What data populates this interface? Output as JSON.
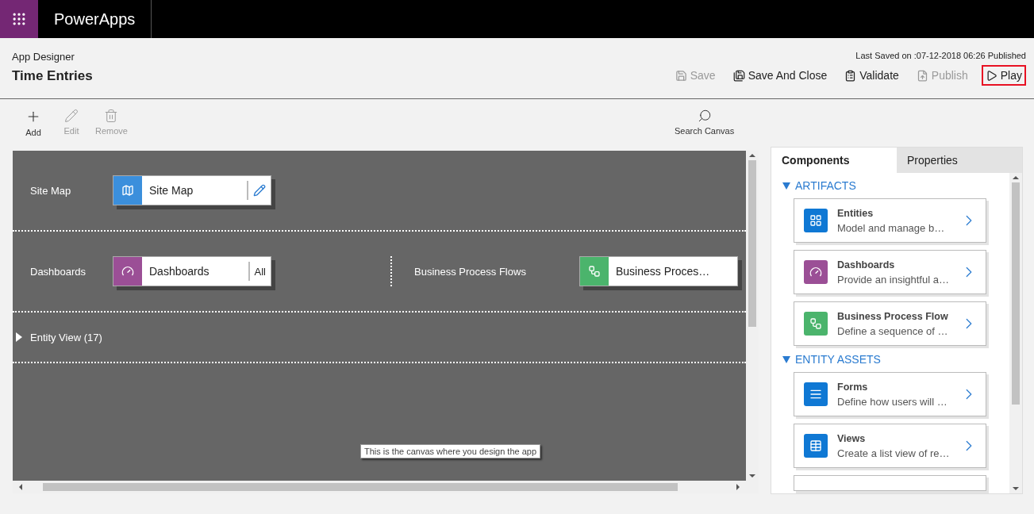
{
  "app_bar": {
    "title": "PowerApps"
  },
  "header": {
    "subtitle": "App Designer",
    "title": "Time Entries",
    "status": "Last Saved on :07-12-2018 06:26 Published",
    "actions": [
      {
        "kind": "save",
        "label": "Save",
        "disabled": true,
        "highlighted": false
      },
      {
        "kind": "save-close",
        "label": "Save And Close",
        "disabled": false,
        "highlighted": false
      },
      {
        "kind": "validate",
        "label": "Validate",
        "disabled": false,
        "highlighted": false
      },
      {
        "kind": "publish",
        "label": "Publish",
        "disabled": true,
        "highlighted": false
      },
      {
        "kind": "play",
        "label": "Play",
        "disabled": false,
        "highlighted": true
      }
    ]
  },
  "toolbar": {
    "tools": [
      {
        "kind": "add",
        "label": "Add",
        "disabled": false
      },
      {
        "kind": "edit",
        "label": "Edit",
        "disabled": true
      },
      {
        "kind": "remove",
        "label": "Remove",
        "disabled": true
      }
    ],
    "search": {
      "label": "Search Canvas"
    }
  },
  "canvas": {
    "rows": [
      {
        "groups": [
          {
            "label": "Site Map",
            "tile": {
              "kind": "map",
              "name": "Site Map",
              "color": "#3b8fdc",
              "action": {
                "kind": "edit"
              }
            }
          }
        ]
      },
      {
        "groups": [
          {
            "label": "Dashboards",
            "tile": {
              "kind": "dashboard",
              "name": "Dashboards",
              "color": "#9b4f96",
              "action": {
                "kind": "text",
                "label": "All"
              }
            }
          },
          {
            "label": "Business Process Flows",
            "tile": {
              "kind": "flow",
              "name": "Business Proces…",
              "color": "#4bb46c"
            }
          }
        ]
      }
    ],
    "entity_view": {
      "label": "Entity View (17)",
      "expanded": false
    },
    "tooltip": "This is the canvas where you design the app"
  },
  "panel": {
    "tabs": [
      {
        "label": "Components",
        "selected": true
      },
      {
        "label": "Properties",
        "selected": false
      }
    ],
    "sections": [
      {
        "title": "ARTIFACTS",
        "expanded": true,
        "items": [
          {
            "kind": "entities",
            "title": "Entities",
            "description": "Model and manage b…",
            "color": "#0f78d4"
          },
          {
            "kind": "dashboard",
            "title": "Dashboards",
            "description": "Provide an insightful a…",
            "color": "#9b4f96"
          },
          {
            "kind": "flow",
            "title": "Business Process Flow",
            "description": "Define a sequence of …",
            "color": "#4bb46c"
          }
        ]
      },
      {
        "title": "ENTITY ASSETS",
        "expanded": true,
        "items": [
          {
            "kind": "forms",
            "title": "Forms",
            "description": "Define how users will …",
            "color": "#0f78d4"
          },
          {
            "kind": "views",
            "title": "Views",
            "description": "Create a list view of re…",
            "color": "#0f78d4"
          },
          {
            "kind": "partial"
          }
        ]
      }
    ]
  }
}
